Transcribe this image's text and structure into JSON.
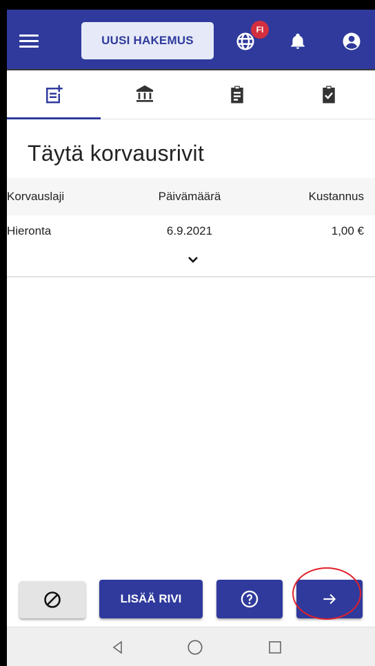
{
  "header": {
    "new_application_label": "UUSI HAKEMUS",
    "language_badge": "FI",
    "icons": [
      "menu-icon",
      "globe-icon",
      "bell-icon",
      "account-icon"
    ]
  },
  "tabs": [
    {
      "icon": "add-document-icon",
      "active": true
    },
    {
      "icon": "bank-icon",
      "active": false
    },
    {
      "icon": "clipboard-icon",
      "active": false
    },
    {
      "icon": "clipboard-check-icon",
      "active": false
    }
  ],
  "page": {
    "title": "Täytä korvausrivit"
  },
  "table": {
    "columns": [
      "Korvauslaji",
      "Päivämäärä",
      "Kustannus"
    ],
    "rows": [
      {
        "type": "Hieronta",
        "date": "6.9.2021",
        "cost": "1,00 €"
      }
    ]
  },
  "footer": {
    "add_row_label": "LISÄÄ RIVI",
    "icons": [
      "cancel-icon",
      "help-icon",
      "arrow-right-icon"
    ]
  },
  "system_nav": {
    "icons": [
      "back-icon",
      "home-icon",
      "recents-icon"
    ]
  },
  "colors": {
    "primary": "#2f3a9c",
    "badge": "#d32f3f",
    "highlight": "#e0202a"
  }
}
